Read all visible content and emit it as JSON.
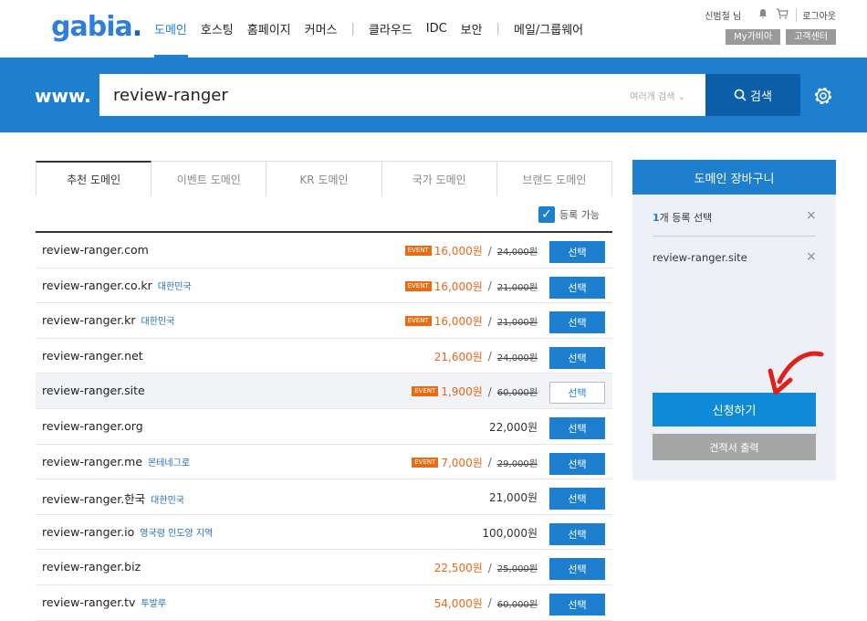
{
  "header": {
    "logo": "gabia",
    "logo_dot": ".",
    "nav": [
      "도메인",
      "호스팅",
      "홈페이지",
      "커머스",
      "|",
      "클라우드",
      "IDC",
      "보안",
      "|",
      "메일/그룹웨어"
    ],
    "user": "신범철 님",
    "logout": "로그아웃",
    "my_gabia": "My가비아",
    "customer_center": "고객센터"
  },
  "search": {
    "prefix": "www.",
    "query": "review-ranger",
    "multi_search": "여러개 검색  ⌄",
    "button": "검색"
  },
  "tabs": [
    "추천 도메인",
    "이벤트 도메인",
    "KR 도메인",
    "국가 도메인",
    "브랜드 도메인"
  ],
  "filter": {
    "label": "등록 가능"
  },
  "domains": [
    {
      "name": "review-ranger.com",
      "country": "",
      "event": "EVENT",
      "price": "16,000원",
      "price_color": "orange",
      "orig": "24,000원",
      "btn": "선택",
      "selected": false
    },
    {
      "name": "review-ranger.co.kr",
      "country": "대한민국",
      "event": "EVENT",
      "price": "16,000원",
      "price_color": "orange",
      "orig": "21,000원",
      "btn": "선택",
      "selected": false
    },
    {
      "name": "review-ranger.kr",
      "country": "대한민국",
      "event": "EVENT",
      "price": "16,000원",
      "price_color": "orange",
      "orig": "21,000원",
      "btn": "선택",
      "selected": false
    },
    {
      "name": "review-ranger.net",
      "country": "",
      "event": "",
      "price": "21,600원",
      "price_color": "orange",
      "orig": "24,000원",
      "btn": "선택",
      "selected": false
    },
    {
      "name": "review-ranger.site",
      "country": "",
      "event": "EVENT",
      "price": "1,900원",
      "price_color": "orange",
      "orig": "60,000원",
      "btn": "선택",
      "selected": true
    },
    {
      "name": "review-ranger.org",
      "country": "",
      "event": "",
      "price": "22,000원",
      "price_color": "plain",
      "orig": "",
      "btn": "선택",
      "selected": false
    },
    {
      "name": "review-ranger.me",
      "country": "몬테네그로",
      "event": "EVENT",
      "price": "7,000원",
      "price_color": "orange",
      "orig": "29,000원",
      "btn": "선택",
      "selected": false
    },
    {
      "name": "review-ranger.한국",
      "country": "대한민국",
      "event": "",
      "price": "21,000원",
      "price_color": "plain",
      "orig": "",
      "btn": "선택",
      "selected": false
    },
    {
      "name": "review-ranger.io",
      "country": "영국령 인도양 지역",
      "event": "",
      "price": "100,000원",
      "price_color": "plain",
      "orig": "",
      "btn": "선택",
      "selected": false
    },
    {
      "name": "review-ranger.biz",
      "country": "",
      "event": "",
      "price": "22,500원",
      "price_color": "orange",
      "orig": "25,000원",
      "btn": "선택",
      "selected": false
    },
    {
      "name": "review-ranger.tv",
      "country": "투발루",
      "event": "",
      "price": "54,000원",
      "price_color": "orange",
      "orig": "60,000원",
      "btn": "선택",
      "selected": false
    }
  ],
  "cart": {
    "title": "도메인 장바구니",
    "count_num": "1",
    "count_text": "개 등록 선택",
    "item": "review-ranger.site",
    "apply": "신청하기",
    "quote": "견적서 출력"
  },
  "colors": {
    "brand_blue": "#1d7fce",
    "event_orange": "#ea6c12",
    "annotation_red": "#e0201b"
  }
}
